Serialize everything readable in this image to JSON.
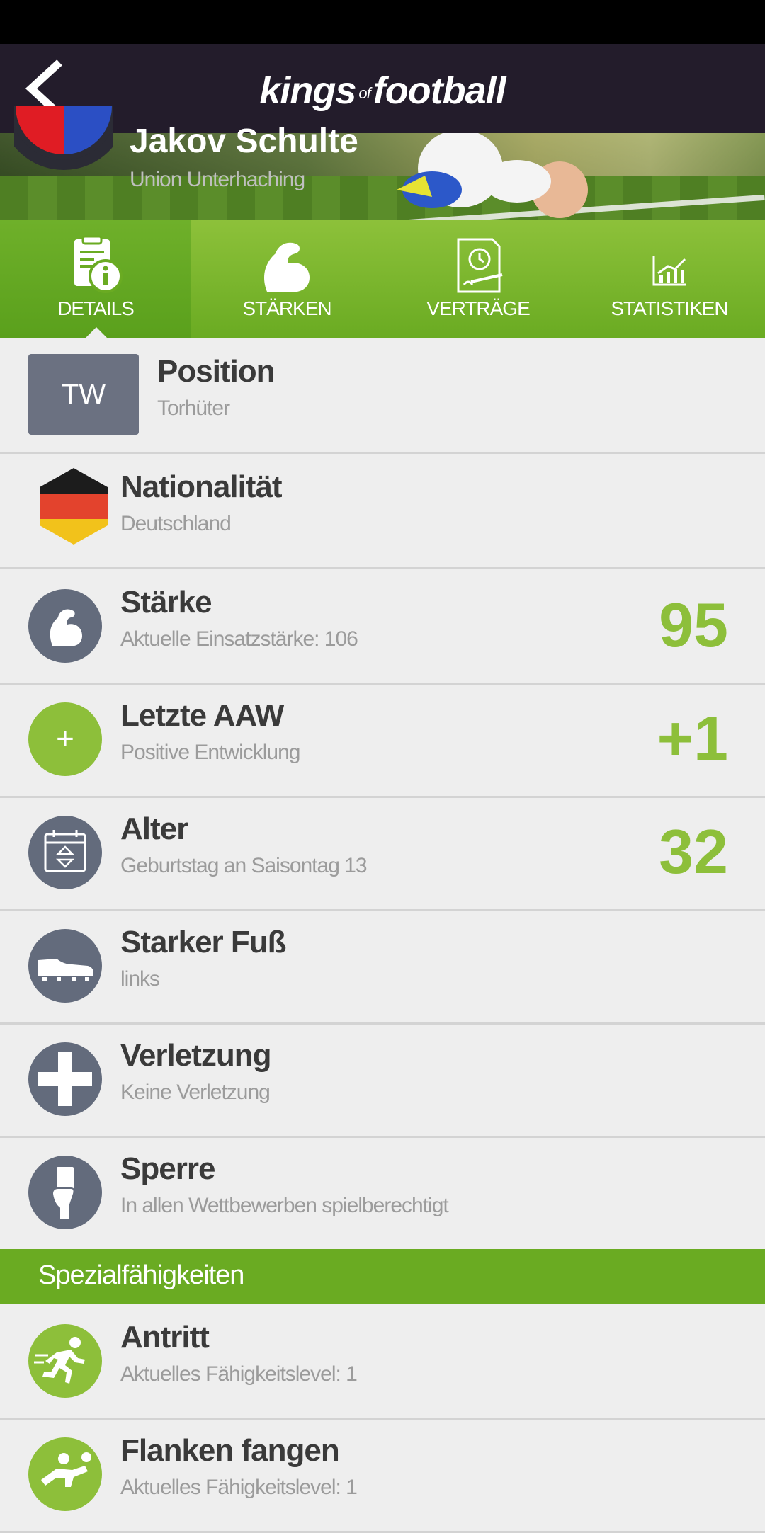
{
  "header": {
    "logo_main": "kings",
    "logo_of": "of",
    "logo_end": "football"
  },
  "player": {
    "name": "Jakov Schulte",
    "club": "Union Unterhaching"
  },
  "tabs": [
    {
      "label": "DETAILS",
      "icon": "document-info-icon",
      "active": true
    },
    {
      "label": "STÄRKEN",
      "icon": "flexed-arm-icon",
      "active": false
    },
    {
      "label": "VERTRÄGE",
      "icon": "contract-icon",
      "active": false
    },
    {
      "label": "STATISTIKEN",
      "icon": "chart-icon",
      "active": false
    }
  ],
  "details": {
    "position": {
      "badge": "TW",
      "title": "Position",
      "subtitle": "Torhüter"
    },
    "nationality": {
      "title": "Nationalität",
      "subtitle": "Deutschland"
    },
    "strength": {
      "title": "Stärke",
      "subtitle": "Aktuelle Einsatzstärke: 106",
      "value": "95"
    },
    "last_aaw": {
      "title": "Letzte AAW",
      "subtitle": "Positive Entwicklung",
      "value": "+1",
      "icon_glyph": "+"
    },
    "age": {
      "title": "Alter",
      "subtitle": "Geburtstag an Saisontag 13",
      "value": "32"
    },
    "foot": {
      "title": "Starker Fuß",
      "subtitle": "links"
    },
    "injury": {
      "title": "Verletzung",
      "subtitle": "Keine Verletzung"
    },
    "suspension": {
      "title": "Sperre",
      "subtitle": "In allen Wettbewerben spielberechtigt"
    }
  },
  "special": {
    "header": "Spezialfähigkeiten",
    "items": [
      {
        "title": "Antritt",
        "subtitle": "Aktuelles Fähigkeitslevel: 1"
      },
      {
        "title": "Flanken fangen",
        "subtitle": "Aktuelles Fähigkeitslevel: 1"
      }
    ]
  },
  "colors": {
    "accent_green": "#8dbf3a",
    "tab_bg": "#6aab22",
    "icon_grey": "#636b7c",
    "topbar": "#231c2b"
  }
}
